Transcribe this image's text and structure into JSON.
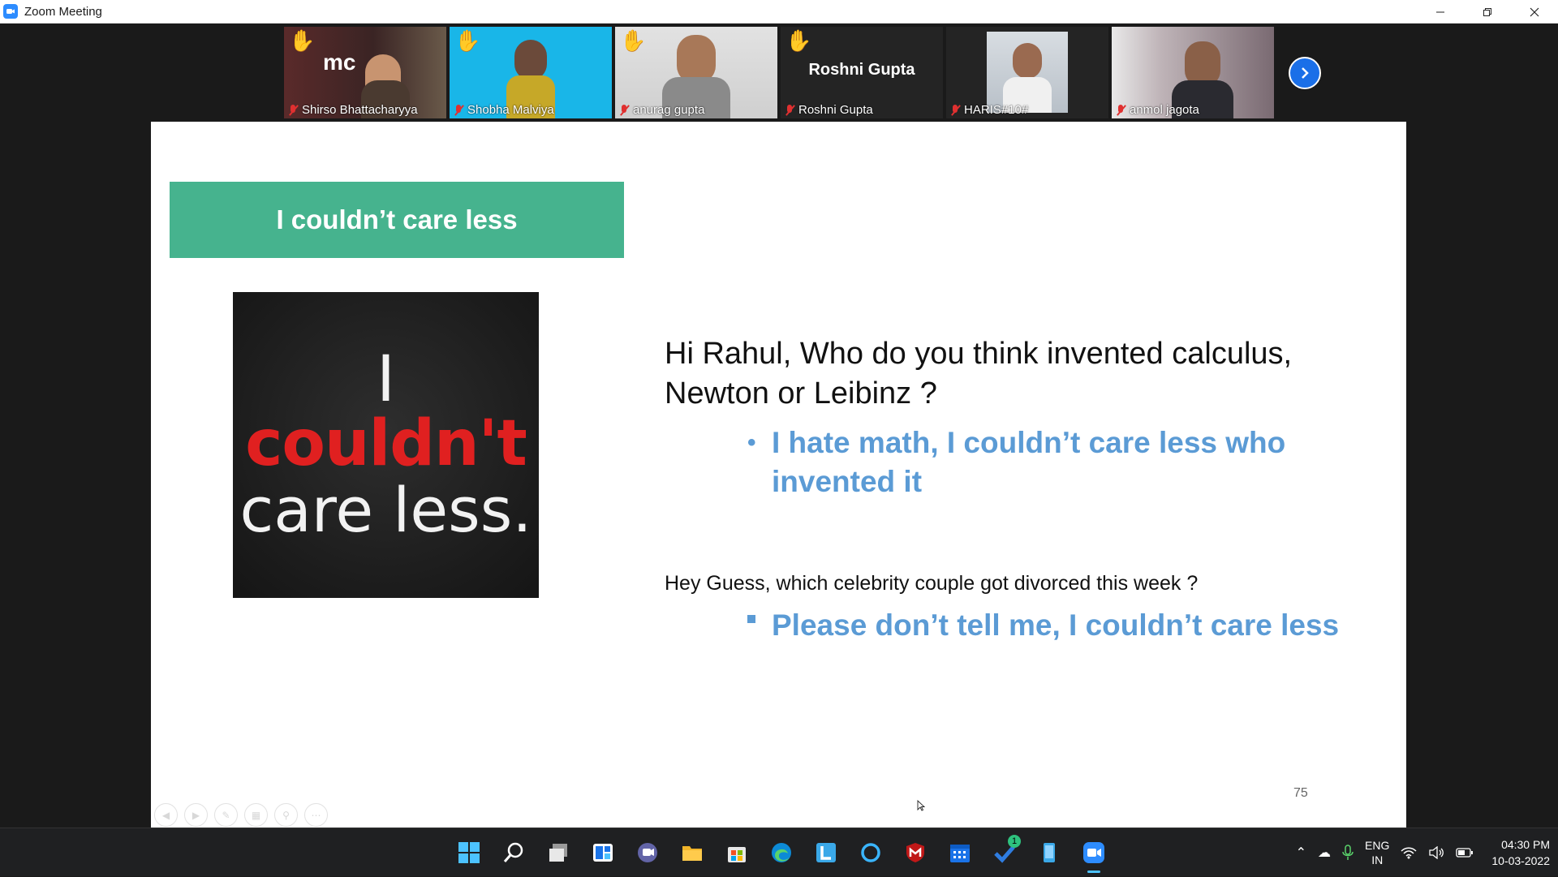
{
  "window": {
    "title": "Zoom Meeting",
    "controls": [
      "minimize",
      "restore",
      "close"
    ]
  },
  "participants": [
    {
      "name": "Shirso Bhattacharyya",
      "hand_raised": true,
      "muted": true,
      "bg": "#5a2a2a",
      "logo_text": "mc"
    },
    {
      "name": "Shobha Malviya",
      "hand_raised": true,
      "muted": true,
      "bg": "#19b6e8"
    },
    {
      "name": "anurag gupta",
      "hand_raised": true,
      "muted": true,
      "bg": "#d8d8d8"
    },
    {
      "name": "Roshni Gupta",
      "hand_raised": true,
      "muted": true,
      "bg": "#242424",
      "display_name": "Roshni Gupta"
    },
    {
      "name": "HARIS#10#",
      "hand_raised": false,
      "muted": true,
      "bg": "#2a2a2a"
    },
    {
      "name": "anmol jagota",
      "hand_raised": false,
      "muted": true,
      "bg": "#8a7a80"
    }
  ],
  "slide": {
    "title": "I couldn’t care less",
    "image_text": {
      "line1": "I",
      "line2": "couldn't",
      "line3": "care less."
    },
    "question1": "Hi Rahul, Who do you think invented calculus, Newton or Leibinz ?",
    "answer1": "I hate math, I couldn’t care less who invented it",
    "question2": "Hey Guess, which celebrity couple got divorced this week ?",
    "answer2": "Please don’t tell me, I couldn’t care less",
    "page_number": "75",
    "colors": {
      "title_bg": "#46b38e",
      "answer": "#5b9bd5",
      "image_accent": "#e02020"
    }
  },
  "taskbar": {
    "apps": [
      "start",
      "search",
      "task-view",
      "widgets",
      "chat",
      "file-explorer",
      "store",
      "edge",
      "launcher-l",
      "cortana",
      "mcafee",
      "calendar",
      "todo",
      "phone",
      "zoom"
    ],
    "todo_badge": "1",
    "tray": {
      "lang_line1": "ENG",
      "lang_line2": "IN",
      "time": "04:30 PM",
      "date": "10-03-2022"
    }
  }
}
